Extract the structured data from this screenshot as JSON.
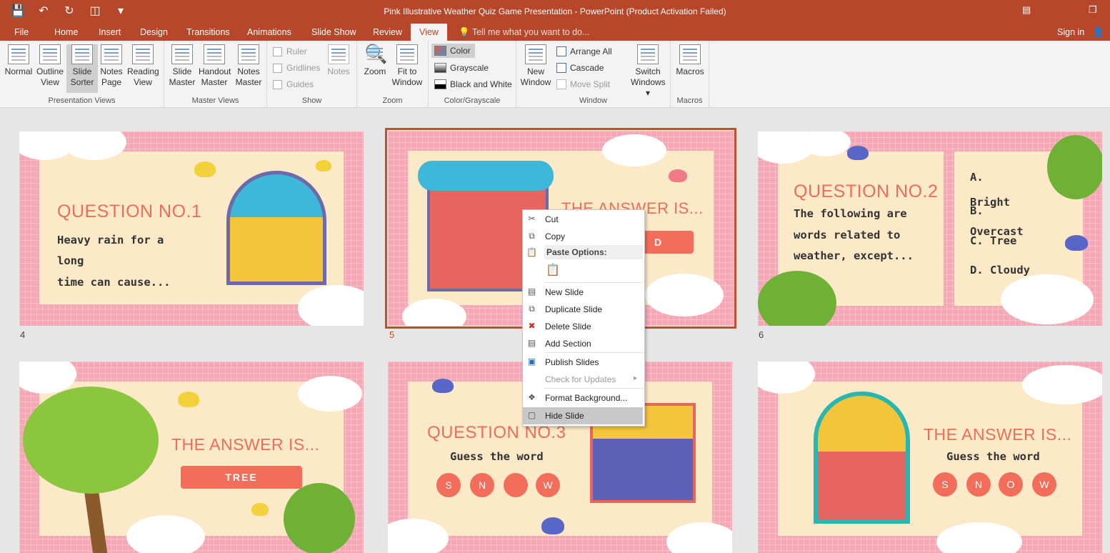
{
  "window": {
    "title": "Pink Illustrative Weather Quiz Game Presentation - PowerPoint (Product Activation Failed)",
    "qat_icons": [
      "save-icon",
      "undo-icon",
      "redo-icon",
      "present-icon",
      "customize-icon"
    ]
  },
  "tabs": [
    {
      "label": "File"
    },
    {
      "label": "Home"
    },
    {
      "label": "Insert"
    },
    {
      "label": "Design"
    },
    {
      "label": "Transitions"
    },
    {
      "label": "Animations"
    },
    {
      "label": "Slide Show"
    },
    {
      "label": "Review"
    },
    {
      "label": "View"
    }
  ],
  "tell_me": "Tell me what you want to do...",
  "sign_in": "Sign in",
  "ribbon": {
    "presentation_views": {
      "label": "Presentation Views",
      "buttons": [
        {
          "l1": "Normal",
          "l2": ""
        },
        {
          "l1": "Outline",
          "l2": "View"
        },
        {
          "l1": "Slide",
          "l2": "Sorter"
        },
        {
          "l1": "Notes",
          "l2": "Page"
        },
        {
          "l1": "Reading",
          "l2": "View"
        }
      ]
    },
    "master_views": {
      "label": "Master Views",
      "buttons": [
        {
          "l1": "Slide",
          "l2": "Master"
        },
        {
          "l1": "Handout",
          "l2": "Master"
        },
        {
          "l1": "Notes",
          "l2": "Master"
        }
      ]
    },
    "show": {
      "label": "Show",
      "ruler": "Ruler",
      "gridlines": "Gridlines",
      "guides": "Guides",
      "notes": "Notes"
    },
    "zoom": {
      "label": "Zoom",
      "zoom": "Zoom",
      "fit1": "Fit to",
      "fit2": "Window"
    },
    "color": {
      "label": "Color/Grayscale",
      "color": "Color",
      "grayscale": "Grayscale",
      "bw": "Black and White"
    },
    "window": {
      "label": "Window",
      "new1": "New",
      "new2": "Window",
      "arrange": "Arrange All",
      "cascade": "Cascade",
      "move": "Move Split",
      "switch1": "Switch",
      "switch2": "Windows"
    },
    "macros": {
      "label": "Macros",
      "macros": "Macros"
    }
  },
  "slides": {
    "s4": {
      "num": "4",
      "title": "QUESTION NO.1",
      "lines": [
        "Heavy  rain  for  a",
        "long",
        "time  can  cause..."
      ]
    },
    "s5": {
      "num": "5",
      "title": "THE ANSWER IS...",
      "answer": "D"
    },
    "s6": {
      "num": "6",
      "title": "QUESTION NO.2",
      "lines": [
        "The  following  are",
        "words  related  to",
        "weather,  except..."
      ],
      "options": [
        "A.",
        "Bright",
        "B.",
        "Overcast",
        "C.  Tree",
        "D.     Cloudy"
      ]
    },
    "s7": {
      "title": "THE ANSWER IS...",
      "answer": "TREE"
    },
    "s8": {
      "title": "QUESTION NO.3",
      "subtitle": "Guess  the  word",
      "letters": [
        "S",
        "N",
        "",
        "W"
      ]
    },
    "s9": {
      "title": "THE ANSWER IS...",
      "subtitle": "Guess  the  word",
      "letters": [
        "S",
        "N",
        "O",
        "W"
      ]
    }
  },
  "context_menu": {
    "cut": "Cut",
    "copy": "Copy",
    "paste_options": "Paste Options:",
    "new_slide": "New Slide",
    "duplicate": "Duplicate Slide",
    "delete": "Delete Slide",
    "add_section": "Add Section",
    "publish": "Publish Slides",
    "check_updates": "Check for Updates",
    "format_bg": "Format Background...",
    "hide": "Hide Slide"
  },
  "colors": {
    "accent": "#b7472a",
    "slide_pink": "#f4a8b6",
    "panel_cream": "#fce9c7",
    "title_coral": "#ee6d58"
  }
}
